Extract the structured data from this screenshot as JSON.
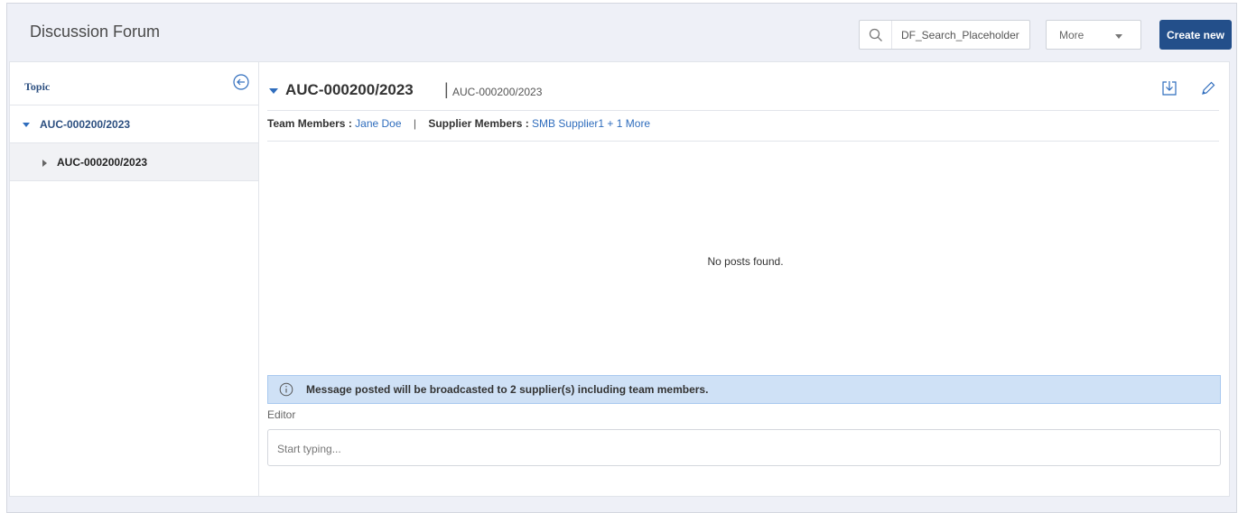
{
  "app": {
    "title": "Discussion Forum"
  },
  "search": {
    "placeholder": "DF_Search_Placeholder"
  },
  "toolbar": {
    "more_label": "More",
    "create_label": "Create new"
  },
  "sidebar": {
    "header": "Topic",
    "items": [
      {
        "label": "AUC-000200/2023",
        "expanded": true
      },
      {
        "label": "AUC-000200/2023",
        "expanded": false,
        "selected": true
      }
    ]
  },
  "topic": {
    "title": "AUC-000200/2023",
    "subtitle": "AUC-000200/2023",
    "team_members_label": "Team Members :",
    "team_members_value": "Jane Doe",
    "supplier_members_label": "Supplier Members :",
    "supplier_members_value": "SMB Supplier1 + 1 More"
  },
  "posts": {
    "empty_text": "No posts found."
  },
  "banner": {
    "text": "Message posted will be broadcasted to 2 supplier(s) including team members."
  },
  "editor": {
    "label": "Editor",
    "placeholder": "Start typing..."
  },
  "colors": {
    "accent": "#234f8a",
    "link": "#2f6dbd",
    "banner_bg": "#cfe1f6"
  }
}
